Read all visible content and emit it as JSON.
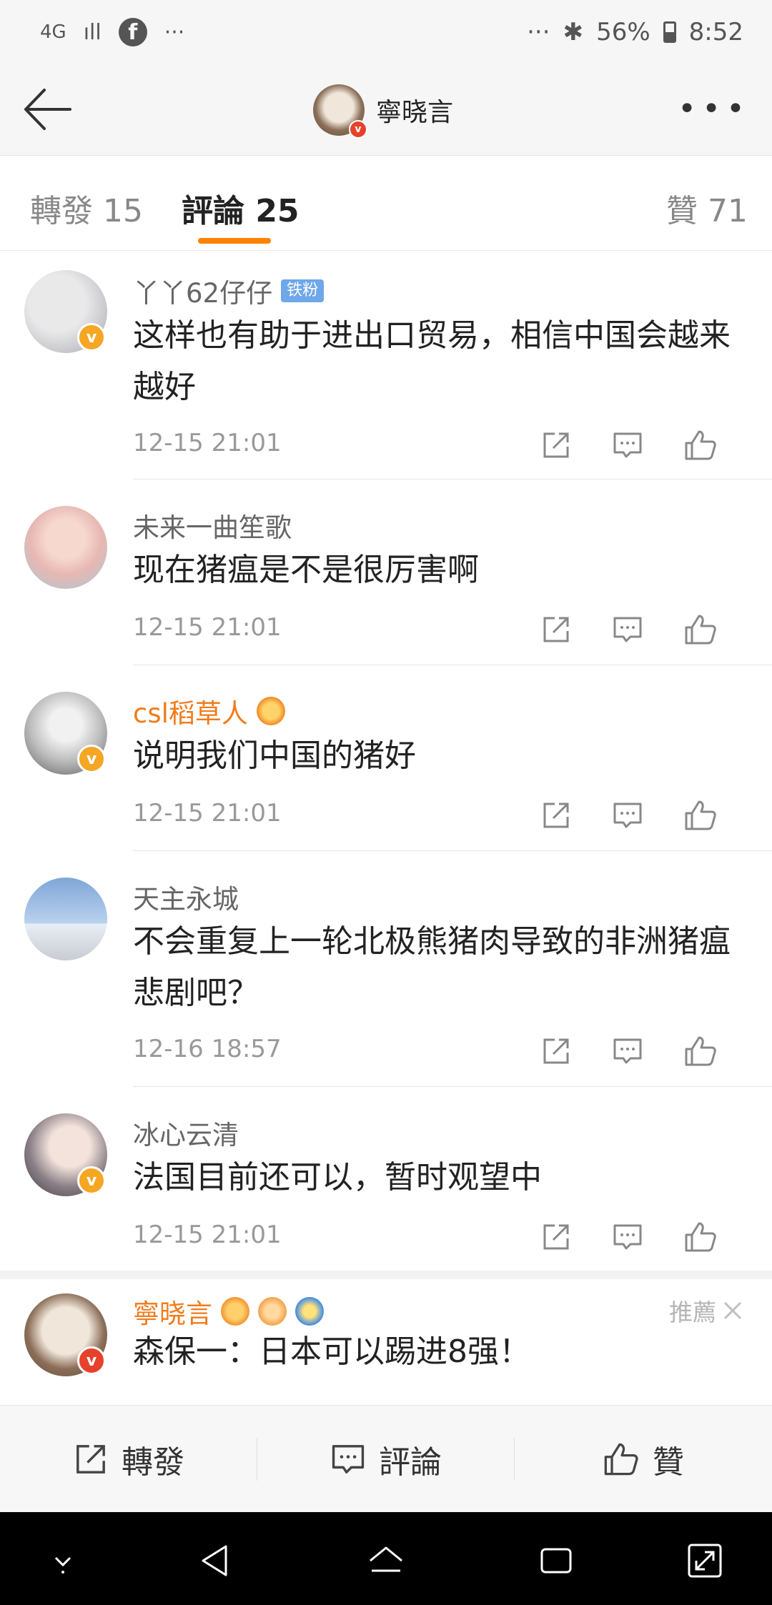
{
  "status_bar": {
    "network": "4G",
    "signal": "ıll",
    "facebook": "f",
    "ellipsis_left": "···",
    "ellipsis_right": "···",
    "bluetooth": "✱",
    "battery_percent": "56%",
    "time": "8:52"
  },
  "header": {
    "title": "寧晓言"
  },
  "tabs": [
    {
      "label": "轉發 15"
    },
    {
      "label": "評論 25"
    },
    {
      "label": "贊 71"
    }
  ],
  "comments": [
    {
      "name": "丫丫62仔仔",
      "tag": "铁粉",
      "text": "这样也有助于进出口贸易，相信中国会越来越好",
      "time": "12-15 21:01"
    },
    {
      "name": "未来一曲笙歌",
      "text": "现在猪瘟是不是很厉害啊",
      "time": "12-15 21:01"
    },
    {
      "name": "csl稻草人",
      "text": "说明我们中国的猪好",
      "time": "12-15 21:01"
    },
    {
      "name": "天主永城",
      "text": "不会重复上一轮北极熊猪肉导致的非洲猪瘟悲剧吧？",
      "time": "12-16 18:57"
    },
    {
      "name": "冰心云清",
      "text": "法国目前还可以，暂时观望中",
      "time": "12-15 21:01"
    },
    {
      "name": "寧晓言",
      "text": "森保一：日本可以踢进8强！",
      "recommend": "推薦"
    }
  ],
  "bottom_bar": {
    "repost": "轉發",
    "comment": "評論",
    "like": "贊"
  },
  "colors": {
    "accent": "#ff8200",
    "verified_gold": "#f5a623",
    "verified_red": "#e6412b"
  }
}
